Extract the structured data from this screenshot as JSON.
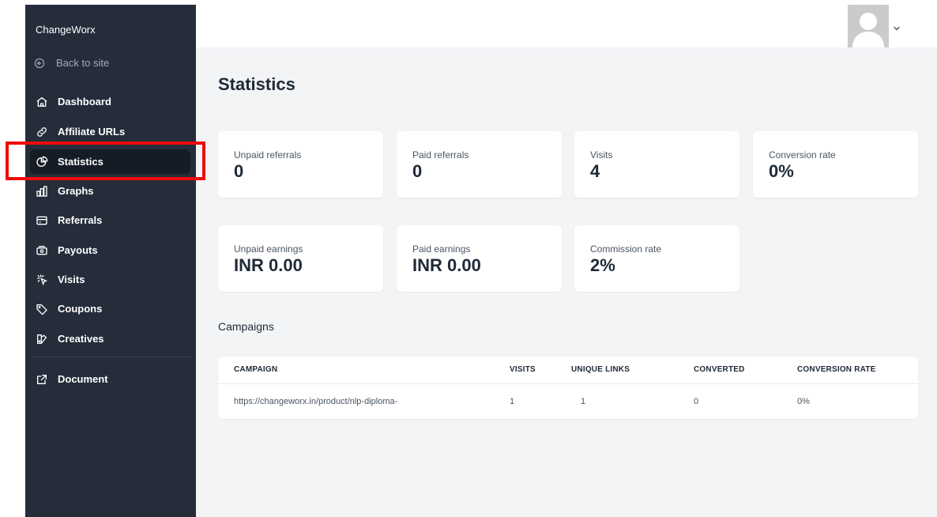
{
  "sidebar": {
    "brand": "ChangeWorx",
    "back_label": "Back to site",
    "items": [
      {
        "label": "Dashboard",
        "icon": "home-icon"
      },
      {
        "label": "Affiliate URLs",
        "icon": "link-icon"
      },
      {
        "label": "Statistics",
        "icon": "pie-chart-icon",
        "active": true
      },
      {
        "label": "Graphs",
        "icon": "bar-chart-icon"
      },
      {
        "label": "Referrals",
        "icon": "credit-card-icon"
      },
      {
        "label": "Payouts",
        "icon": "cash-icon"
      },
      {
        "label": "Visits",
        "icon": "cursor-click-icon"
      },
      {
        "label": "Coupons",
        "icon": "tag-icon"
      },
      {
        "label": "Creatives",
        "icon": "color-swatch-icon"
      }
    ],
    "document_label": "Document"
  },
  "page": {
    "title": "Statistics"
  },
  "stats": [
    {
      "label": "Unpaid referrals",
      "value": "0"
    },
    {
      "label": "Paid referrals",
      "value": "0"
    },
    {
      "label": "Visits",
      "value": "4"
    },
    {
      "label": "Conversion rate",
      "value": "0%"
    },
    {
      "label": "Unpaid earnings",
      "value": "INR 0.00"
    },
    {
      "label": "Paid earnings",
      "value": "INR 0.00"
    },
    {
      "label": "Commission rate",
      "value": "2%"
    }
  ],
  "campaigns": {
    "title": "Campaigns",
    "headers": [
      "CAMPAIGN",
      "VISITS",
      "UNIQUE LINKS",
      "CONVERTED",
      "CONVERSION RATE"
    ],
    "rows": [
      [
        "https://changeworx.in/product/nlp-diploma-",
        "1",
        "1",
        "0",
        "0%"
      ]
    ]
  },
  "colors": {
    "sidebar_bg": "#252d3b",
    "active_bg": "#161c26",
    "main_bg": "#f3f4f6",
    "highlight": "#ef0b0b"
  }
}
